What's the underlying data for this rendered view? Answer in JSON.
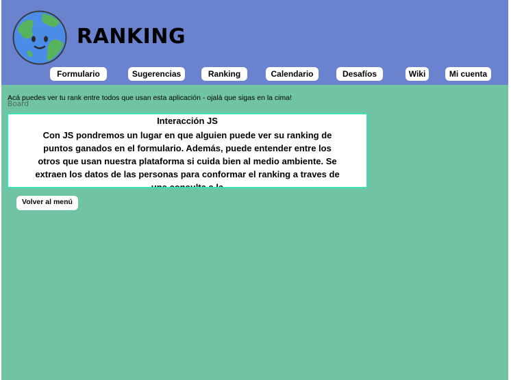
{
  "header": {
    "title": "RANKING",
    "logo_icon": "earth-globe-smiling-icon"
  },
  "nav": {
    "items": [
      {
        "label": "Formulario"
      },
      {
        "label": "Sugerencias"
      },
      {
        "label": "Ranking"
      },
      {
        "label": "Calendario"
      },
      {
        "label": "Desafíos"
      },
      {
        "label": "Wiki"
      },
      {
        "label": "Mi cuenta"
      }
    ]
  },
  "main": {
    "intro": "Acá puedes ver tu rank entre todos que usan esta aplicación - ojalá que sigas en la cima!",
    "board_label": "Board",
    "box": {
      "title": "Interacción JS",
      "body": "Con JS pondremos un lugar en que alguien puede ver su ranking de puntos ganados en el formulario. Además, puede entender entre los otros que usan nuestra plataforma si cuida bien al medio ambiente. Se extraen los datos de las personas para conformar el ranking a traves de una consulta a la"
    },
    "back_button": "Volver al menú"
  },
  "colors": {
    "header_bg": "#6b82cf",
    "page_bg": "#70c4a4",
    "box_border": "#3fe0b6"
  }
}
